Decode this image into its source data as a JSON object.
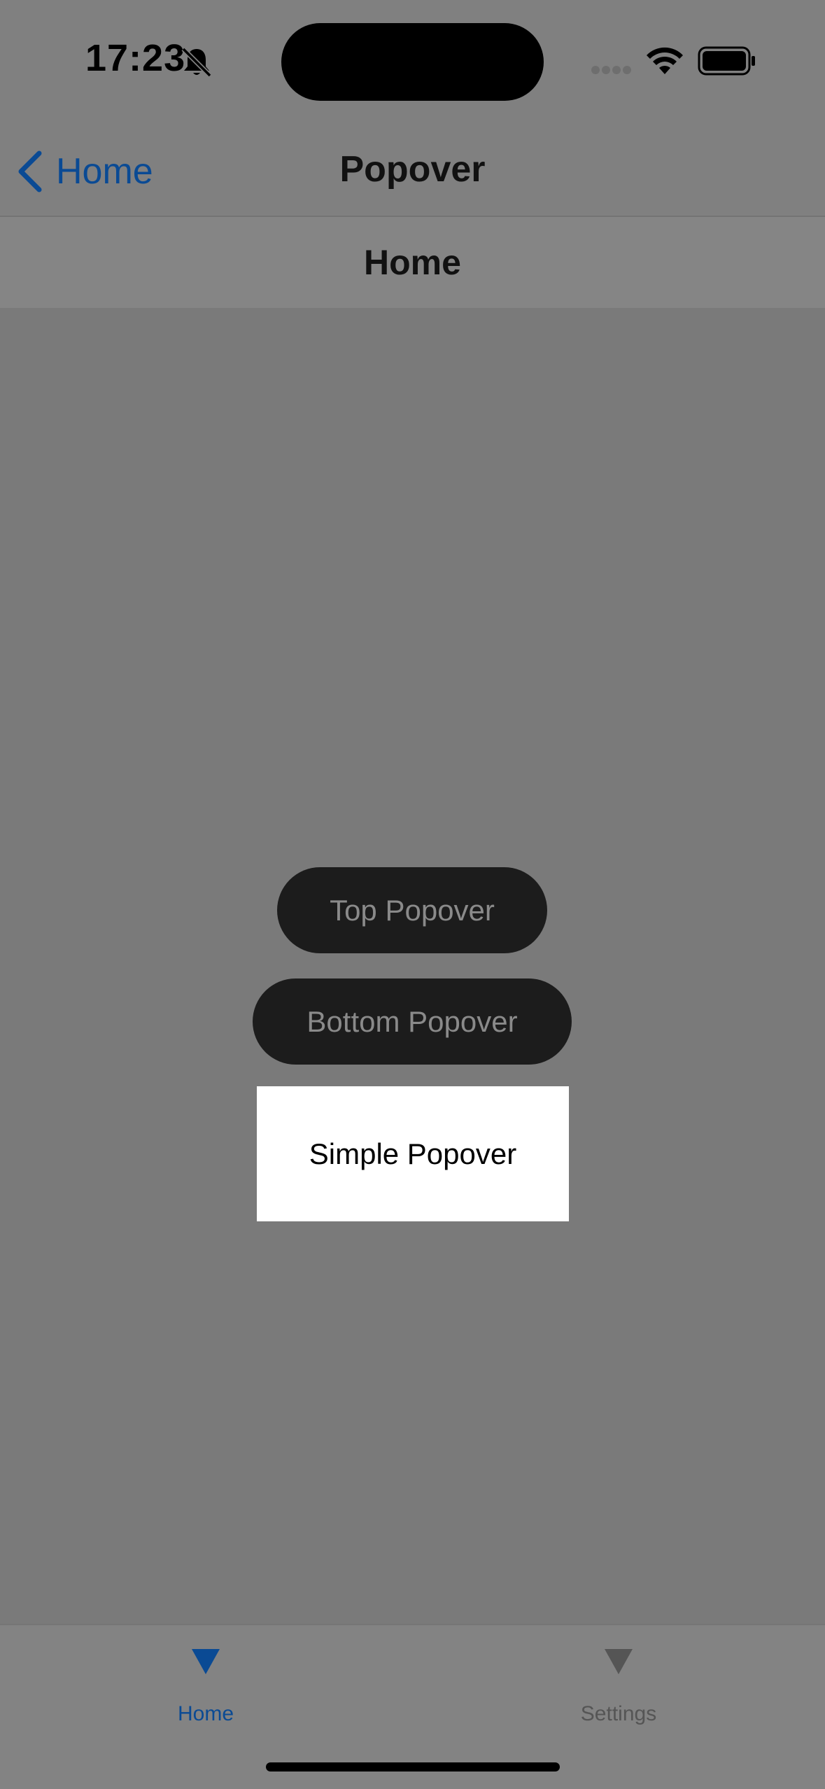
{
  "status_bar": {
    "time": "17:23",
    "icons": [
      "bell-slash-icon",
      "cellular-signal-icon",
      "wifi-icon",
      "battery-icon"
    ]
  },
  "nav": {
    "back_label": "Home",
    "title": "Popover"
  },
  "page_header": {
    "title": "Home"
  },
  "buttons": {
    "top_popover": "Top Popover",
    "bottom_popover": "Bottom Popover"
  },
  "popover": {
    "text": "Simple Popover"
  },
  "tab_bar": {
    "tabs": [
      {
        "label": "Home",
        "icon": "triangle-down-icon",
        "selected": true,
        "color": "#0a4a94"
      },
      {
        "label": "Settings",
        "icon": "triangle-down-icon",
        "selected": false,
        "color": "#555555"
      }
    ]
  },
  "colors": {
    "accent": "#0a4a94",
    "dim_overlay": "#7a7a7a",
    "button_bg": "#1c1c1c"
  }
}
